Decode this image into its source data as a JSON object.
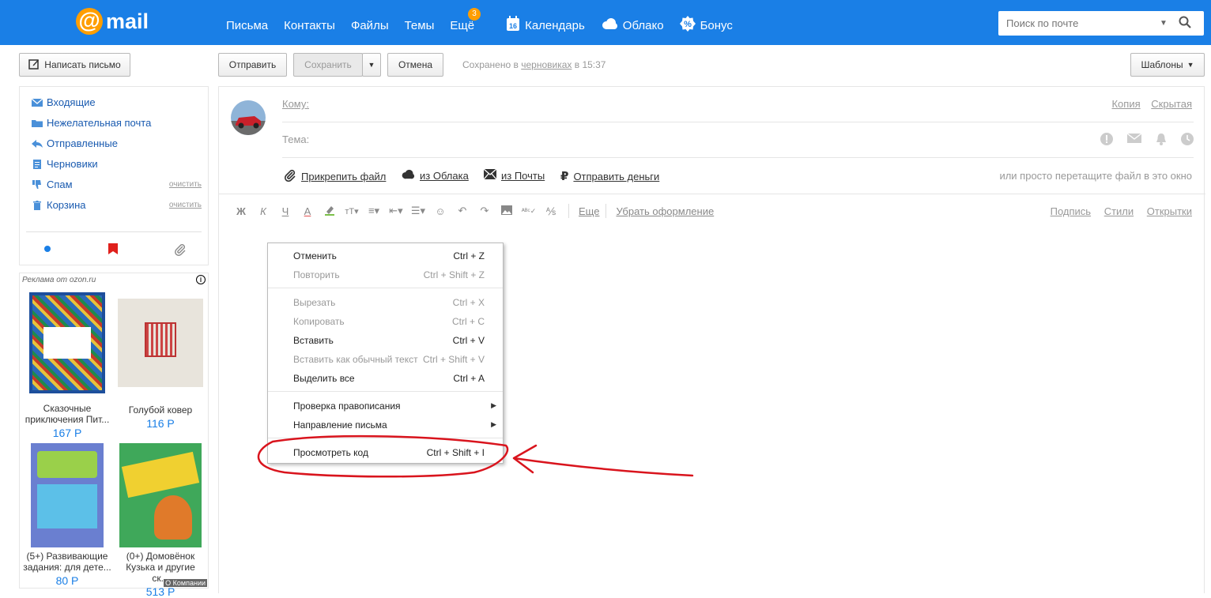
{
  "logo": {
    "text": "mail"
  },
  "nav": {
    "items": [
      {
        "label": "Письма"
      },
      {
        "label": "Контакты"
      },
      {
        "label": "Файлы"
      },
      {
        "label": "Темы"
      },
      {
        "label": "Ещё",
        "badge": "3"
      },
      {
        "label": "Календарь",
        "icon_day": "16"
      },
      {
        "label": "Облако"
      },
      {
        "label": "Бонус"
      }
    ]
  },
  "search": {
    "placeholder": "Поиск по почте"
  },
  "compose_button": "Написать письмо",
  "toolbar": {
    "send": "Отправить",
    "save": "Сохранить",
    "cancel": "Отмена",
    "saved_prefix": "Сохранено в",
    "saved_link": "черновиках",
    "saved_suffix": "в 15:37",
    "templates": "Шаблоны"
  },
  "folders": [
    {
      "label": "Входящие"
    },
    {
      "label": "Нежелательная почта"
    },
    {
      "label": "Отправленные"
    },
    {
      "label": "Черновики"
    },
    {
      "label": "Спам",
      "action": "очистить"
    },
    {
      "label": "Корзина",
      "action": "очистить"
    }
  ],
  "ad": {
    "label": "Реклама от ozon.ru",
    "company": "О Компании",
    "items": [
      {
        "title": "Сказочные приключения Пит...",
        "price": "167 Р"
      },
      {
        "title": "Голубой ковер",
        "price": "116 Р"
      },
      {
        "title": "(5+) Развивающие задания: для дете...",
        "price": "80 Р"
      },
      {
        "title": "(0+) Домовёнок Кузька и другие ск...",
        "price": "513 Р"
      }
    ]
  },
  "compose": {
    "to_label": "Кому:",
    "subject_label": "Тема:",
    "copy": "Копия",
    "hidden": "Скрытая",
    "attach_file": "Прикрепить файл",
    "from_cloud": "из Облака",
    "from_mail": "из Почты",
    "send_money": "Отправить деньги",
    "drag_hint": "или просто перетащите файл в это окно",
    "more": "Еще",
    "clear_format": "Убрать оформление",
    "signature": "Подпись",
    "styles": "Стили",
    "postcards": "Открытки"
  },
  "context_menu": [
    {
      "label": "Отменить",
      "shortcut": "Ctrl + Z",
      "disabled": false
    },
    {
      "label": "Повторить",
      "shortcut": "Ctrl + Shift + Z",
      "disabled": true
    },
    {
      "label": "Вырезать",
      "shortcut": "Ctrl + X",
      "disabled": true
    },
    {
      "label": "Копировать",
      "shortcut": "Ctrl + C",
      "disabled": true
    },
    {
      "label": "Вставить",
      "shortcut": "Ctrl + V",
      "disabled": false
    },
    {
      "label": "Вставить как обычный текст",
      "shortcut": "Ctrl + Shift + V",
      "disabled": true
    },
    {
      "label": "Выделить все",
      "shortcut": "Ctrl + A",
      "disabled": false
    },
    {
      "label": "Проверка правописания",
      "shortcut": "",
      "submenu": true
    },
    {
      "label": "Направление письма",
      "shortcut": "",
      "submenu": true
    },
    {
      "label": "Просмотреть код",
      "shortcut": "Ctrl + Shift + I",
      "disabled": false
    }
  ],
  "colors": {
    "brand": "#1a7fe6",
    "accent": "#ff9e00",
    "annotation": "#d9141d"
  }
}
